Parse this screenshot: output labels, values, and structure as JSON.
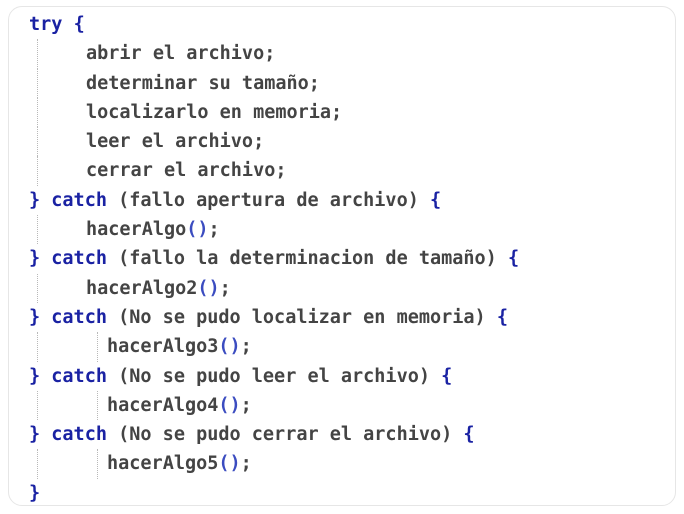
{
  "code": {
    "try_keyword": "try",
    "catch_keyword": "catch",
    "open_brace": "{",
    "close_brace": "}",
    "call_parens": "()",
    "semicolon": ";",
    "try_body": [
      "abrir el archivo;",
      "determinar su tamaño;",
      "localizarlo en memoria;",
      "leer el archivo;",
      "cerrar el archivo;"
    ],
    "catch_conditions": [
      "(fallo apertura de archivo)",
      "(fallo la determinacion de tamaño)",
      "(No se pudo localizar en memoria)",
      "(No se pudo leer el archivo)",
      "(No se pudo cerrar el archivo)"
    ],
    "handlers": [
      "hacerAlgo",
      "hacerAlgo2",
      "hacerAlgo3",
      "hacerAlgo4",
      "hacerAlgo5"
    ]
  },
  "colors": {
    "keyword": "#1a22a3",
    "text": "#444444",
    "guide": "#b8b8b8"
  }
}
